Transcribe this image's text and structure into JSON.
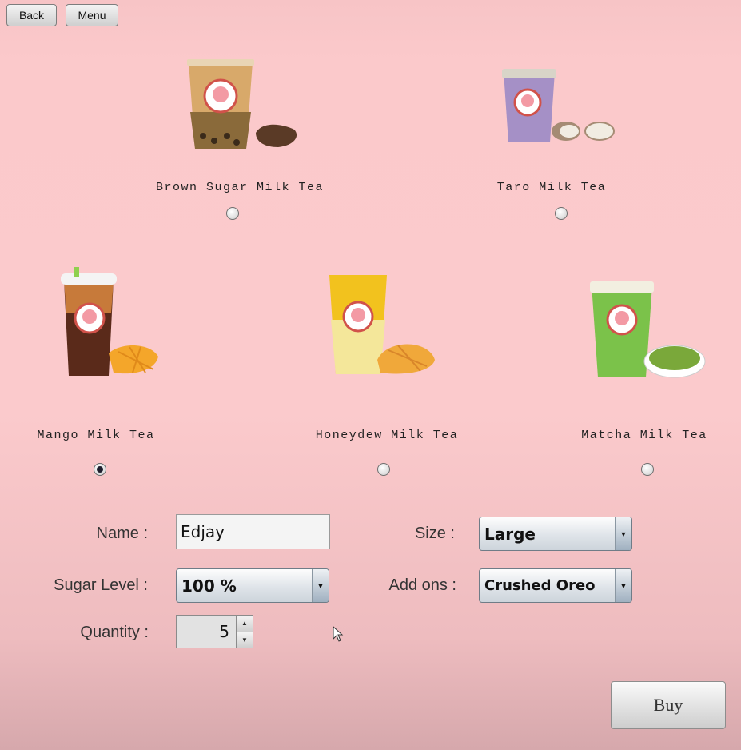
{
  "nav": {
    "back_label": "Back",
    "menu_label": "Menu"
  },
  "products": [
    {
      "name": "Brown Sugar Milk Tea",
      "selected": false
    },
    {
      "name": "Taro Milk Tea",
      "selected": false
    },
    {
      "name": "Mango Milk Tea",
      "selected": true
    },
    {
      "name": "Honeydew Milk Tea",
      "selected": false
    },
    {
      "name": "Matcha Milk Tea",
      "selected": false
    }
  ],
  "form": {
    "name_label": "Name :",
    "name_value": "Edjay",
    "size_label": "Size :",
    "size_value": "Large",
    "sugar_label": "Sugar Level :",
    "sugar_value": "100 %",
    "addons_label": "Add ons :",
    "addons_value": "Crushed Oreo",
    "quantity_label": "Quantity :",
    "quantity_value": "5"
  },
  "buy_label": "Buy",
  "colors": {
    "background": "#fbcacc",
    "radio_checked": "#1f1f2e"
  }
}
